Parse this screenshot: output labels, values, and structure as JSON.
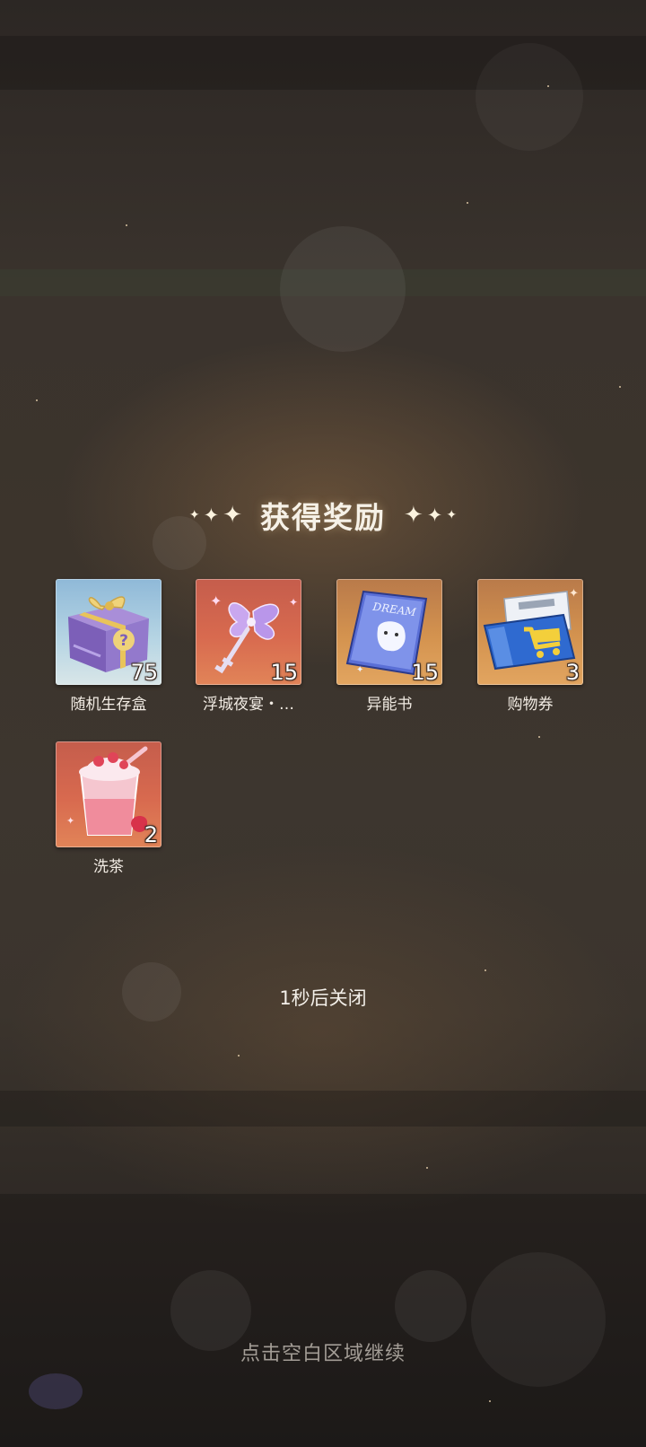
{
  "popup": {
    "title": "获得奖励"
  },
  "rewards": [
    {
      "name": "随机生存盒",
      "quantity": "75",
      "icon": "purple-gift-box-icon",
      "bg": "#a9cbe0"
    },
    {
      "name": "浮城夜宴・…",
      "quantity": "15",
      "icon": "butterfly-key-icon",
      "bg": "#d56a50"
    },
    {
      "name": "异能书",
      "quantity": "15",
      "icon": "dream-book-icon",
      "bg": "#d29050"
    },
    {
      "name": "购物券",
      "quantity": "3",
      "icon": "shopping-ticket-icon",
      "bg": "#d29050"
    },
    {
      "name": "洗茶",
      "quantity": "2",
      "icon": "strawberry-drink-icon",
      "bg": "#d56a50"
    }
  ],
  "countdown_text": "1秒后关闭",
  "continue_hint": "点击空白区域继续"
}
